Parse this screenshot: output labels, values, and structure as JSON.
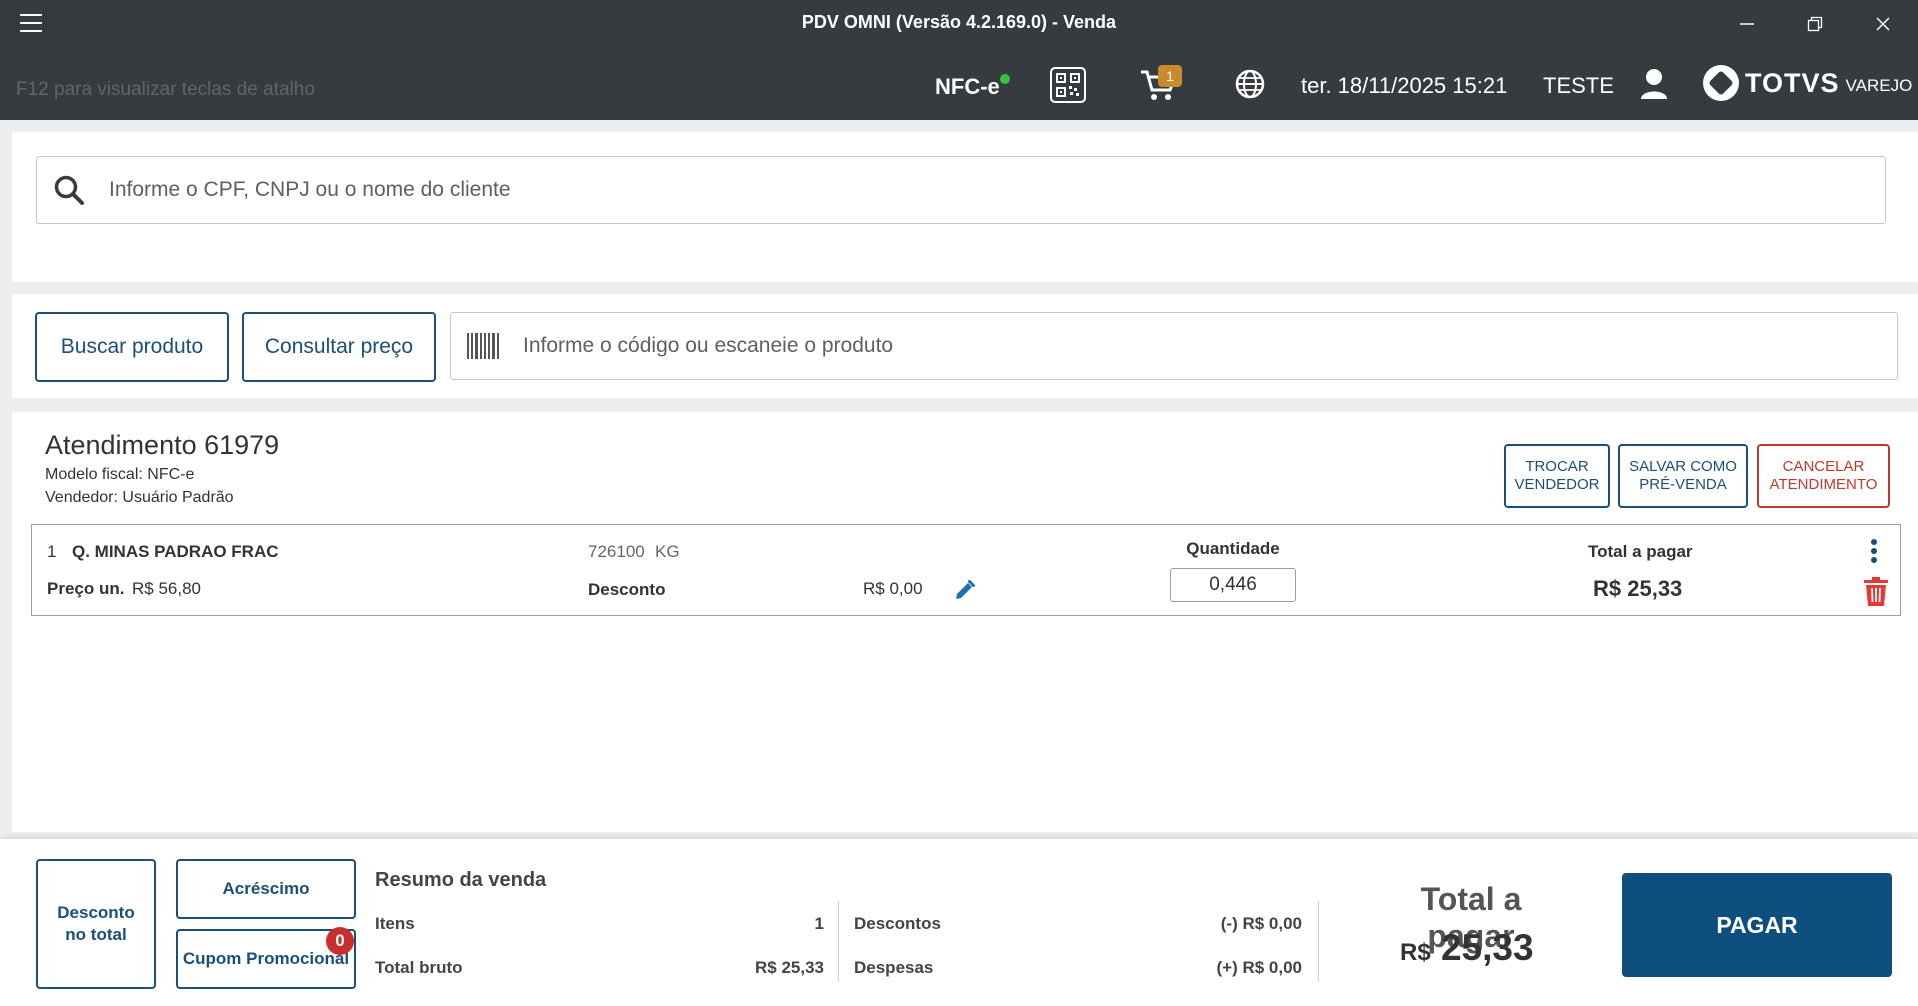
{
  "window": {
    "title": "PDV OMNI (Versão 4.2.169.0) - Venda"
  },
  "header": {
    "hint": "F12 para visualizar teclas de atalho",
    "nfce": "NFC-e",
    "cart_count": "1",
    "datetime": "ter. 18/11/2025 15:21",
    "user": "TESTE",
    "logo_text": "TOTVS",
    "logo_sub": "VAREJO"
  },
  "client": {
    "placeholder": "Informe o CPF, CNPJ ou o nome do cliente"
  },
  "product": {
    "search_label": "Buscar produto",
    "price_label": "Consultar preço",
    "placeholder": "Informe o código ou escaneie o produto"
  },
  "sale": {
    "title": "Atendimento 61979",
    "fiscal_model": "Modelo fiscal: NFC-e",
    "seller": "Vendedor: Usuário Padrão",
    "actions": {
      "change_seller": [
        "TROCAR",
        "VENDEDOR"
      ],
      "save_presale": [
        "SALVAR COMO",
        "PRÉ-VENDA"
      ],
      "cancel": [
        "CANCELAR",
        "ATENDIMENTO"
      ]
    }
  },
  "items": [
    {
      "index": "1",
      "name": "Q. MINAS PADRAO FRAC",
      "code": "726100",
      "unit": "KG",
      "unit_price_label": "Preço un.",
      "unit_price": "R$ 56,80",
      "discount_label": "Desconto",
      "discount": "R$ 0,00",
      "qty_label": "Quantidade",
      "qty": "0,446",
      "total_label": "Total a pagar",
      "total": "R$ 25,33"
    }
  ],
  "footer": {
    "discount_total": [
      "Desconto",
      "no total"
    ],
    "surcharge": "Acréscimo",
    "coupon": "Cupom Promocional",
    "coupon_count": "0",
    "summary_title": "Resumo da venda",
    "items_label": "Itens",
    "items_value": "1",
    "gross_label": "Total bruto",
    "gross_value": "R$ 25,33",
    "discounts_label": "Descontos",
    "discounts_value": "(-) R$ 0,00",
    "expenses_label": "Despesas",
    "expenses_value": "(+) R$ 0,00",
    "total_label": "Total a pagar",
    "total_currency": "R$",
    "total_value": "25,33",
    "pay_label": "PAGAR"
  },
  "colors": {
    "header_bg": "#353b3f",
    "primary": "#0e4f7f",
    "danger": "#c0392b",
    "badge": "#c9892d",
    "online": "#36c23f"
  }
}
